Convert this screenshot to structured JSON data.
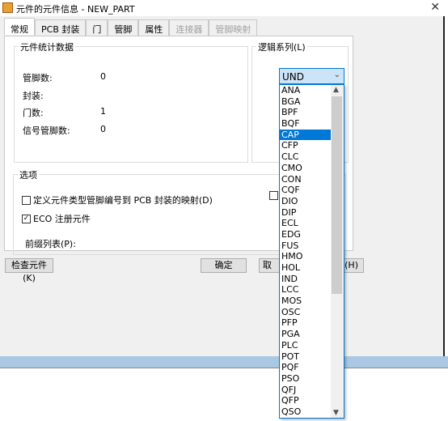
{
  "window": {
    "title": "元件的元件信息 - NEW_PART",
    "close_icon": "close-icon"
  },
  "tabs": [
    {
      "label": "常规",
      "active": true
    },
    {
      "label": "PCB 封装"
    },
    {
      "label": "门"
    },
    {
      "label": "管脚"
    },
    {
      "label": "属性"
    },
    {
      "label": "连接器",
      "disabled": true
    },
    {
      "label": "管脚映射",
      "disabled": true
    }
  ],
  "stats": {
    "title": "元件统计数据",
    "rows": [
      {
        "label": "管脚数:",
        "value": "0"
      },
      {
        "label": "封装:",
        "value": ""
      },
      {
        "label": "门数:",
        "value": "1"
      },
      {
        "label": "信号管脚数:",
        "value": "0"
      }
    ]
  },
  "logic_family": {
    "title": "逻辑系列(L)",
    "selected": "UND",
    "highlighted": "CAP",
    "options": [
      "ANA",
      "BGA",
      "BPF",
      "BQF",
      "CAP",
      "CFP",
      "CLC",
      "CMO",
      "CON",
      "CQF",
      "DIO",
      "DIP",
      "ECL",
      "EDG",
      "FUS",
      "HMO",
      "HOL",
      "IND",
      "LCC",
      "MOS",
      "OSC",
      "PFP",
      "PGA",
      "PLC",
      "POT",
      "PQF",
      "PSO",
      "QFJ",
      "QFP",
      "QSO"
    ]
  },
  "options": {
    "title": "选项",
    "map_pins": {
      "label": "定义元件类型管脚编号到 PCB 封装的映射(D)",
      "checked": false
    },
    "eco": {
      "label": "ECO 注册元件",
      "checked": true
    },
    "hidden_checkbox": {
      "checked": false
    },
    "prefix_label": "前缀列表(P):"
  },
  "buttons": {
    "check": "检查元件(K)",
    "ok": "确定",
    "cancel": "取",
    "help": "(H)"
  },
  "colors": {
    "accent": "#0078d7",
    "combo_bg": "#cce4f7"
  }
}
